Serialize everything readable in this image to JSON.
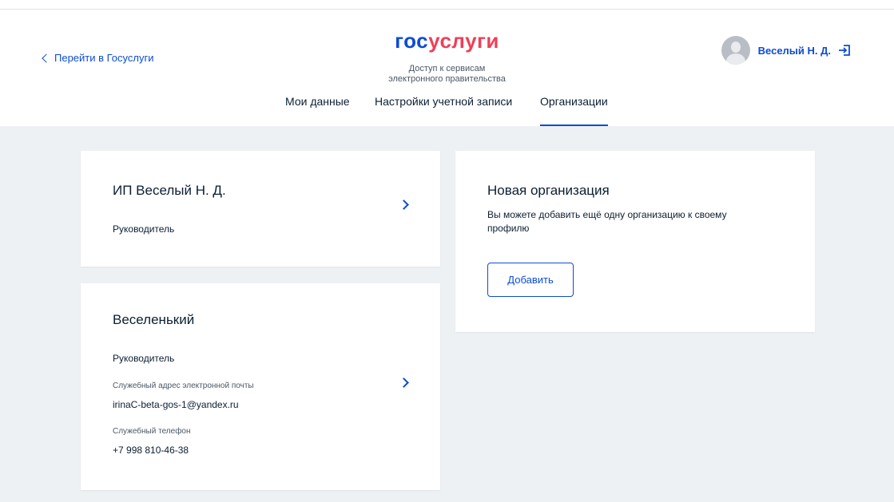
{
  "header": {
    "back_link": "Перейти в Госуслуги",
    "logo_part1": "гос",
    "logo_part2": "услуги",
    "subtitle_line1": "Доступ к сервисам",
    "subtitle_line2": "электронного правительства",
    "user_name": "Веселый Н. Д."
  },
  "tabs": [
    {
      "label": "Мои данные",
      "active": false
    },
    {
      "label": "Настройки учетной записи",
      "active": false
    },
    {
      "label": "Организации",
      "active": true
    }
  ],
  "organizations": [
    {
      "name": "ИП Веселый Н. Д.",
      "role": "Руководитель"
    },
    {
      "name": "Веселенький",
      "role": "Руководитель",
      "email_label": "Служебный адрес электронной почты",
      "email": "irinaC-beta-gos-1@yandex.ru",
      "phone_label": "Служебный телефон",
      "phone": "+7 998 810-46-38"
    }
  ],
  "new_org": {
    "title": "Новая организация",
    "description": "Вы можете добавить ещё одну организацию к своему профилю",
    "button": "Добавить"
  },
  "colors": {
    "brand_blue": "#0d4cd3",
    "brand_red": "#ee3f58",
    "background": "#eef1f4"
  },
  "icons": {
    "back": "chevron-left-icon",
    "logout": "logout-icon",
    "avatar": "user-avatar-icon",
    "open": "chevron-right-icon"
  }
}
